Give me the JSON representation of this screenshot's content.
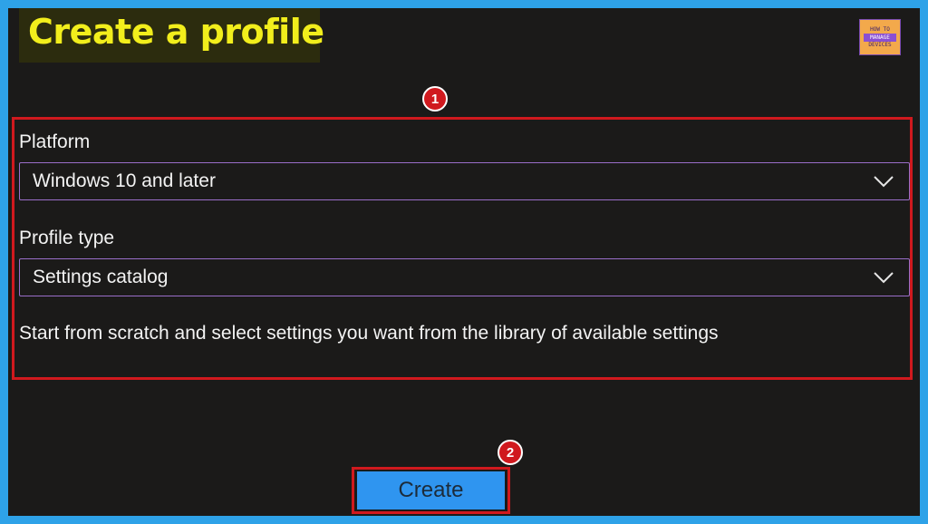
{
  "header": {
    "title": "Create a profile",
    "logo": {
      "line1": "HOW TO",
      "line2": "MANAGE",
      "line3": "DEVICES"
    }
  },
  "annotations": {
    "step1": "1",
    "step2": "2"
  },
  "form": {
    "platform_label": "Platform",
    "platform_value": "Windows 10 and later",
    "profile_type_label": "Profile type",
    "profile_type_value": "Settings catalog",
    "description": "Start from scratch and select settings you want from the library of available settings"
  },
  "actions": {
    "create_label": "Create"
  },
  "colors": {
    "background_frame": "#2ea2e8",
    "panel": "#1b1a19",
    "title_text": "#f2ee1c",
    "highlight": "#d0191e",
    "dropdown_border": "#9a6ec9",
    "create_button": "#2f95f0"
  },
  "icons": {
    "dropdown": "chevron-down-icon"
  }
}
